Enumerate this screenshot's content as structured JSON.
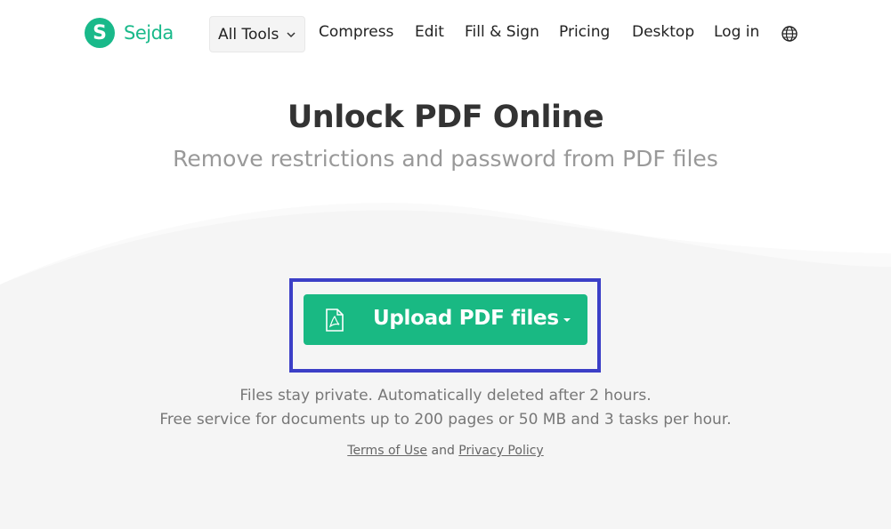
{
  "brand": {
    "logo_letter": "S",
    "name": "Sejda",
    "color": "#19b98a"
  },
  "nav": {
    "all_tools": "All Tools",
    "compress": "Compress",
    "edit": "Edit",
    "fill_sign": "Fill & Sign",
    "pricing": "Pricing",
    "desktop": "Desktop",
    "login": "Log in",
    "language_icon": "globe-icon"
  },
  "hero": {
    "title": "Unlock PDF Online",
    "subtitle": "Remove restrictions and password from PDF files"
  },
  "upload": {
    "label": "Upload PDF files",
    "icon": "pdf-file-icon",
    "color": "#19b983",
    "highlight_color": "#3c3fc7"
  },
  "info": {
    "line1": "Files stay private. Automatically deleted after 2 hours.",
    "line2": "Free service for documents up to 200 pages or 50 MB and 3 tasks per hour."
  },
  "legal": {
    "terms": "Terms of Use",
    "and": "and",
    "privacy": "Privacy Policy"
  }
}
